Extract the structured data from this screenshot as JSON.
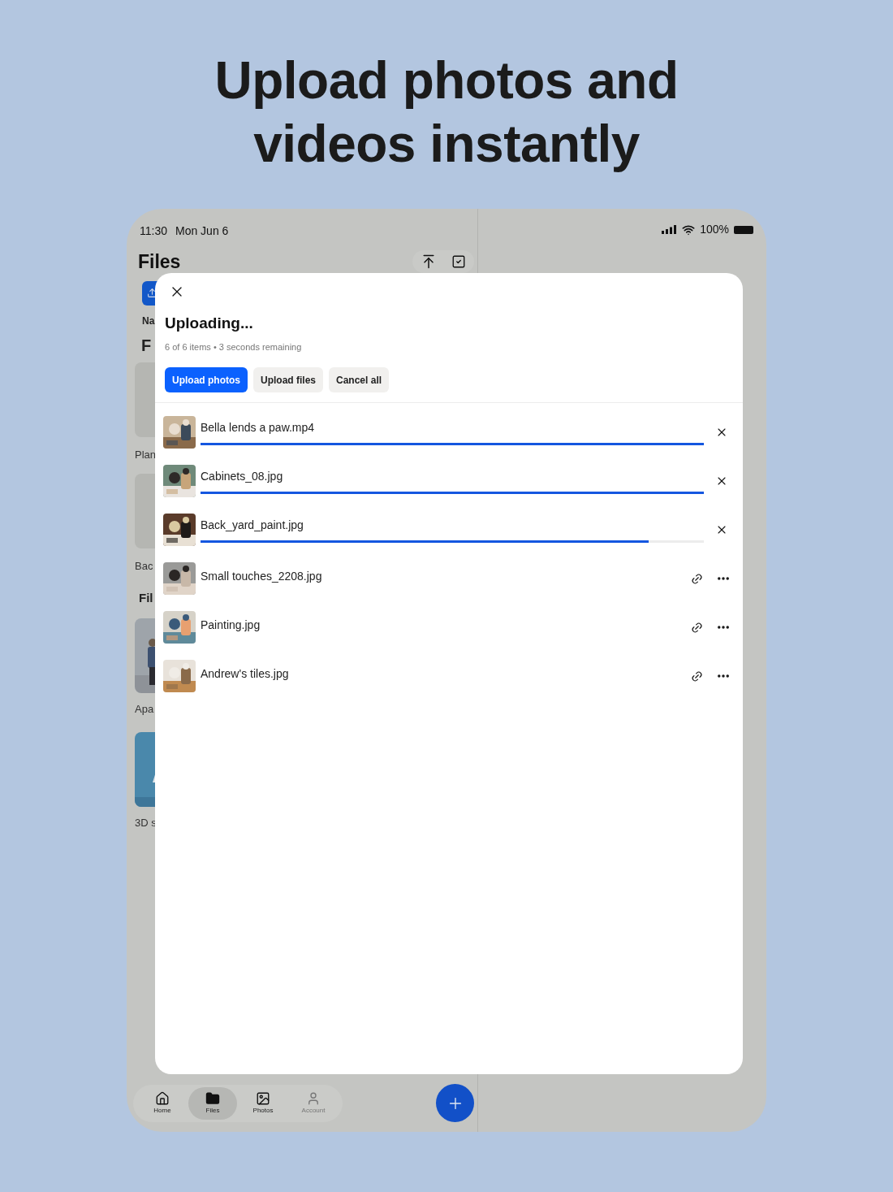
{
  "headline": {
    "lines": [
      "Upload photos and",
      "videos instantly"
    ]
  },
  "status_bar": {
    "time": "11:30",
    "date": "Mon Jun 6",
    "battery": "100%"
  },
  "files_pane": {
    "title": "Files",
    "sort_label": "Na",
    "section_1": "F",
    "folders": [
      {
        "name": "Plan",
        "kind": "blank"
      },
      {
        "name": "Bac",
        "kind": "blank"
      }
    ],
    "section_2": "Fil",
    "files": [
      {
        "name": "Apa",
        "kind": "picture"
      },
      {
        "name": "3D s",
        "kind": "model"
      }
    ]
  },
  "upload_sheet": {
    "title": "Uploading...",
    "subtitle": "6 of 6 items • 3 seconds remaining",
    "buttons": [
      {
        "label": "Upload photos",
        "selected": true
      },
      {
        "label": "Upload files",
        "selected": false
      },
      {
        "label": "Cancel all",
        "selected": false
      }
    ],
    "items": [
      {
        "name": "Bella lends a paw.mp4",
        "kind": "uploading",
        "level": 1
      },
      {
        "name": "Cabinets_08.jpg",
        "kind": "uploading",
        "level": 1
      },
      {
        "name": "Back_yard_paint.jpg",
        "kind": "uploading",
        "level": 0.89
      },
      {
        "name": "Small touches_2208.jpg",
        "kind": "done"
      },
      {
        "name": "Painting.jpg",
        "kind": "done"
      },
      {
        "name": "Andrew's tiles.jpg",
        "kind": "done"
      }
    ]
  },
  "tab_bar": [
    {
      "label": "Home",
      "selected": false
    },
    {
      "label": "Files",
      "selected": true
    },
    {
      "label": "Photos",
      "selected": false
    },
    {
      "label": "Account",
      "selected": false
    }
  ]
}
